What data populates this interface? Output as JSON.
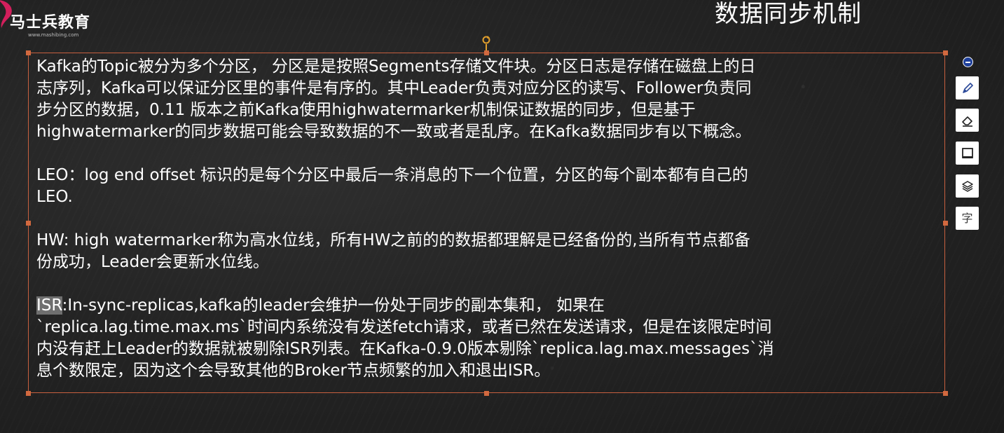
{
  "logo": {
    "name": "马士兵教育",
    "url_text": "www.mashibing.com"
  },
  "slide": {
    "title": "数据同步机制",
    "paragraphs": [
      {
        "lines": [
          "Kafka的Topic被分为多个分区， 分区是是按照Segments存储文件块。分区日志是存储在磁盘上的日",
          "志序列，Kafka可以保证分区里的事件是有序的。其中Leader负责对应分区的读写、Follower负责同",
          "步分区的数据，0.11 版本之前Kafka使用highwatermarker机制保证数据的同步，但是基于",
          "highwatermarker的同步数据可能会导致数据的不一致或者是乱序。在Kafka数据同步有以下概念。"
        ]
      },
      {
        "lines": [
          "LEO：log end offset 标识的是每个分区中最后一条消息的下一个位置，分区的每个副本都有自己的",
          "LEO."
        ]
      },
      {
        "lines": [
          "HW: high watermarker称为高水位线，所有HW之前的的数据都理解是已经备份的,当所有节点都备",
          "份成功，Leader会更新水位线。"
        ]
      },
      {
        "highlight": "ISR",
        "first_line_rest": ":In-sync-replicas,kafka的leader会维护一份处于同步的副本集和， 如果在",
        "lines": [
          "`replica.lag.time.max.ms`时间内系统没有发送fetch请求，或者已然在发送请求，但是在该限定时间",
          "内没有赶上Leader的数据就被剔除ISR列表。在Kafka-0.9.0版本剔除`replica.lag.max.messages`消",
          "息个数限定，因为这个会导致其他的Broker节点频繁的加入和退出ISR。"
        ]
      }
    ]
  },
  "toolbar": {
    "items": [
      {
        "name": "collapse",
        "icon": "minus-circle-icon"
      },
      {
        "name": "pen",
        "icon": "pen-icon"
      },
      {
        "name": "eraser",
        "icon": "eraser-icon"
      },
      {
        "name": "board",
        "icon": "board-icon"
      },
      {
        "name": "layers",
        "icon": "layers-icon"
      },
      {
        "name": "text",
        "icon": "text-char-icon",
        "glyph": "字"
      }
    ]
  },
  "colors": {
    "background": "#232323",
    "text": "#ffffff",
    "selection_border": "#c8603f",
    "handle": "#d2693f",
    "rotate_handle": "#e2a02d",
    "highlight": "#6f6f6f",
    "toolbar_accent": "#1e3f9a"
  }
}
